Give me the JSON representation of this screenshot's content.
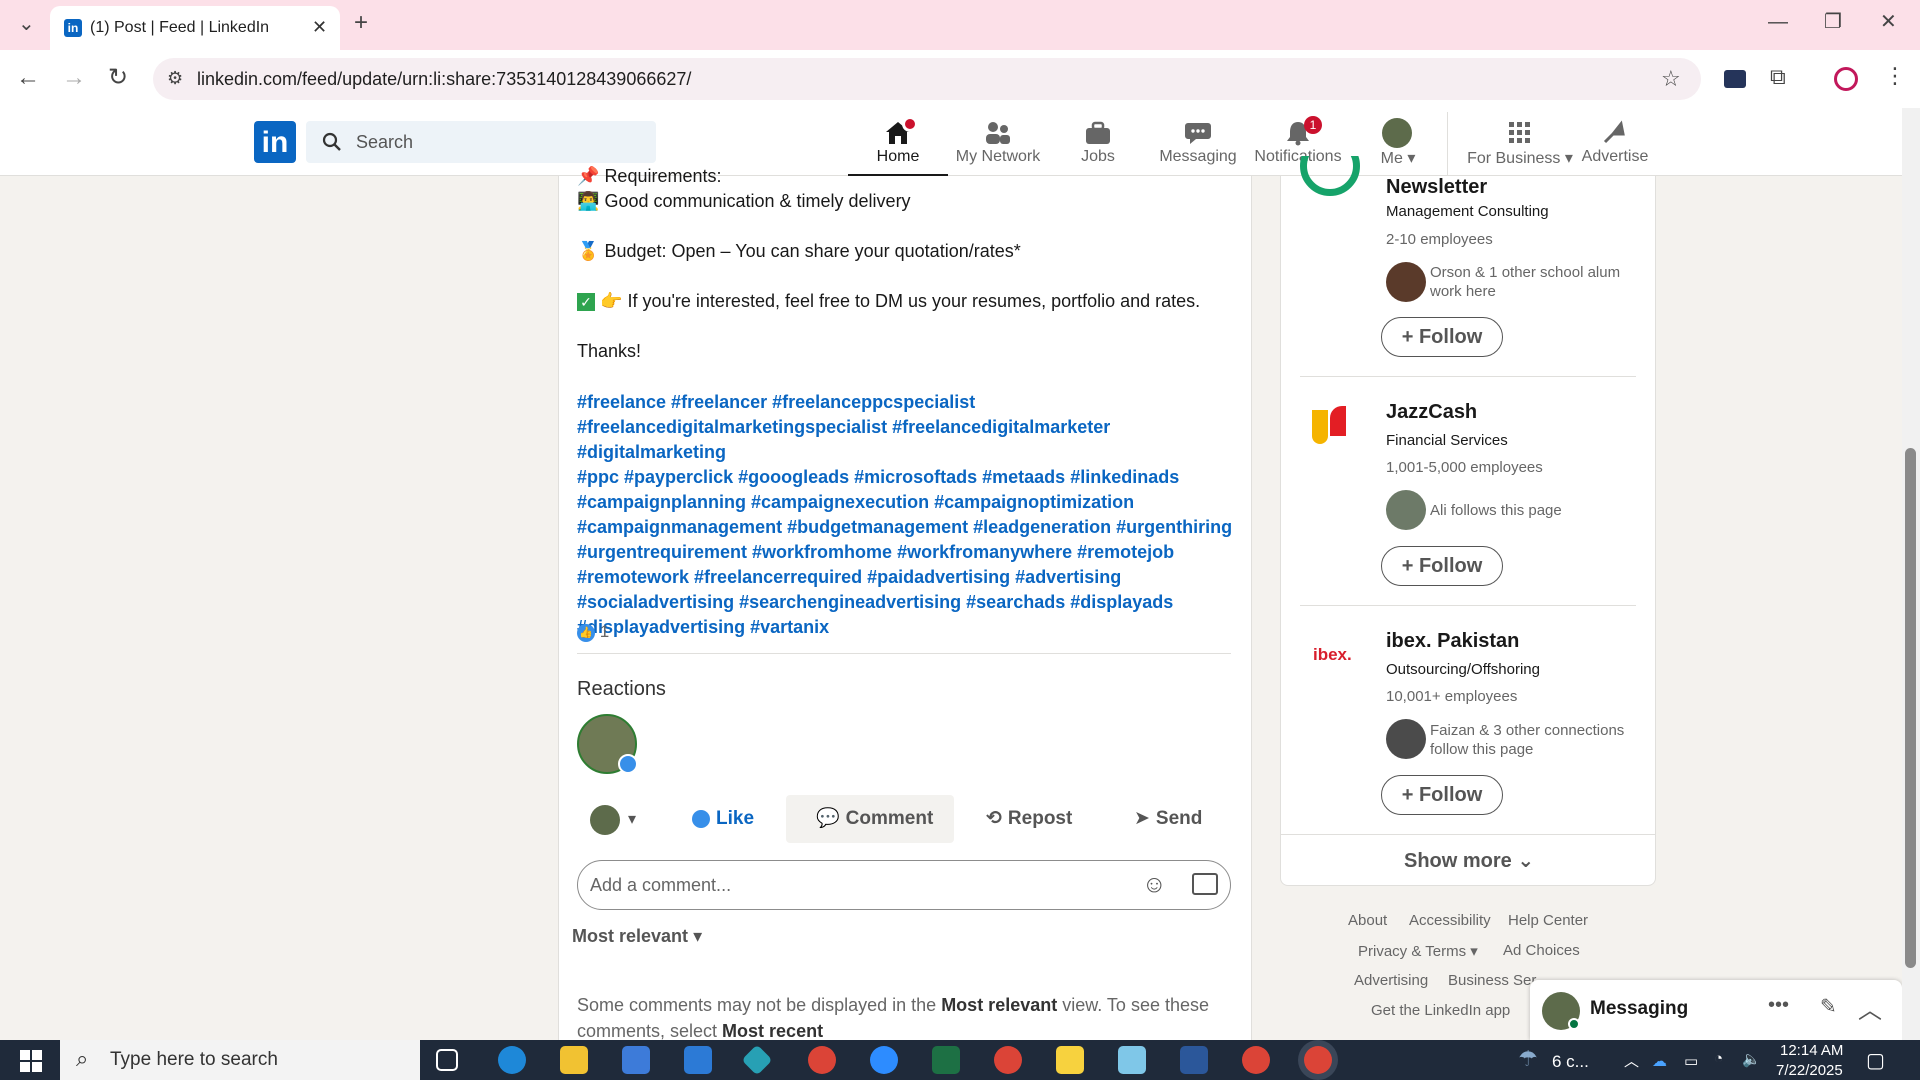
{
  "browser": {
    "tab_title": "(1) Post | Feed | LinkedIn",
    "url": "linkedin.com/feed/update/urn:li:share:7353140128439066627/"
  },
  "header": {
    "search_placeholder": "Search",
    "nav": [
      {
        "label": "Home",
        "icon": "home-icon",
        "badge": ""
      },
      {
        "label": "My Network",
        "icon": "network-icon"
      },
      {
        "label": "Jobs",
        "icon": "jobs-icon"
      },
      {
        "label": "Messaging",
        "icon": "messaging-icon"
      },
      {
        "label": "Notifications",
        "icon": "bell-icon",
        "badge": "1"
      },
      {
        "label": "Me",
        "icon": "avatar"
      },
      {
        "label": "For Business",
        "icon": "grid-icon"
      },
      {
        "label": "Advertise",
        "icon": "advertise-icon"
      }
    ]
  },
  "post": {
    "requirements_line": "Requirements:",
    "line_communication": "Good communication & timely delivery",
    "line_budget": "Budget: Open – You can share your quotation/rates*",
    "line_interest": "If you're interested, feel free to DM us your resumes, portfolio and rates.",
    "thanks": "Thanks!",
    "hashtags": [
      "#freelance #freelancer #freelanceppcspecialist",
      "#freelancedigitalmarketingspecialist #freelancedigitalmarketer #digitalmarketing",
      "#ppc #payperclick #gooogleads #microsoftads #metaads #linkedinads",
      "#campaignplanning #campaignexecution #campaignoptimization",
      "#campaignmanagement #budgetmanagement #leadgeneration #urgenthiring",
      "#urgentrequirement #workfromhome #workfromanywhere #remotejob",
      "#remotework #freelancerrequired #paidadvertising #advertising",
      "#socialadvertising #searchengineadvertising #searchads #displayads",
      "#displayadvertising #vartanix"
    ],
    "reaction_count": "1",
    "reactions_heading": "Reactions",
    "actions": {
      "like": "Like",
      "comment": "Comment",
      "repost": "Repost",
      "send": "Send"
    },
    "comment_placeholder": "Add a comment...",
    "sort_label": "Most relevant",
    "notice_prefix": "Some comments may not be displayed in the ",
    "notice_bold": "Most relevant",
    "notice_suffix": " view. To see these",
    "notice_line2_prefix": "comments, select ",
    "notice_line2_bold": "Most recent"
  },
  "sidebar": {
    "companies": [
      {
        "name": "Newsletter",
        "industry": "Management Consulting",
        "size": "2-10 employees",
        "connections": "Orson & 1 other school alum work here",
        "follow": "Follow"
      },
      {
        "name": "JazzCash",
        "industry": "Financial Services",
        "size": "1,001-5,000 employees",
        "connections": "Ali follows this page",
        "follow": "Follow"
      },
      {
        "name": "ibex. Pakistan",
        "logo_text": "ibex.",
        "industry": "Outsourcing/Offshoring",
        "size": "10,001+ employees",
        "connections": "Faizan & 3 other connections follow this page",
        "follow": "Follow"
      }
    ],
    "show_more": "Show more"
  },
  "footer": {
    "about": "About",
    "accessibility": "Accessibility",
    "help": "Help Center",
    "privacy": "Privacy & Terms",
    "adchoices": "Ad Choices",
    "advertising": "Advertising",
    "business": "Business Ser",
    "app": "Get the LinkedIn app"
  },
  "messaging": {
    "title": "Messaging"
  },
  "taskbar": {
    "search_placeholder": "Type here to search",
    "weather": "6 c...",
    "time": "12:14 AM",
    "date": "7/22/2025"
  },
  "colors": {
    "linkedin_blue": "#0a66c2",
    "tab_bar": "#fce0e8",
    "badge_red": "#cb112d"
  }
}
